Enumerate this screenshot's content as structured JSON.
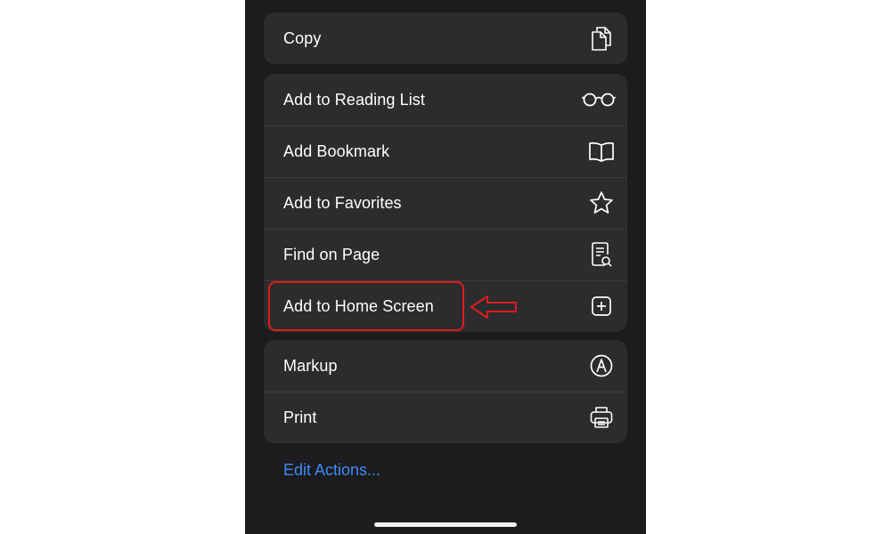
{
  "groups": [
    {
      "items": [
        {
          "label": "Copy",
          "icon": "copy-icon"
        }
      ]
    },
    {
      "items": [
        {
          "label": "Add to Reading List",
          "icon": "glasses-icon"
        },
        {
          "label": "Add Bookmark",
          "icon": "book-icon"
        },
        {
          "label": "Add to Favorites",
          "icon": "star-icon"
        },
        {
          "label": "Find on Page",
          "icon": "find-in-document-icon"
        },
        {
          "label": "Add to Home Screen",
          "icon": "plus-square-icon"
        }
      ]
    },
    {
      "items": [
        {
          "label": "Markup",
          "icon": "markup-pen-icon"
        },
        {
          "label": "Print",
          "icon": "printer-icon"
        }
      ]
    }
  ],
  "edit_actions": "Edit Actions...",
  "annotation": {
    "color": "#e01b1b",
    "target": "Add to Home Screen"
  },
  "colors": {
    "background": "#1c1c1e",
    "group": "#2c2c2e",
    "link": "#3d8bf5"
  }
}
